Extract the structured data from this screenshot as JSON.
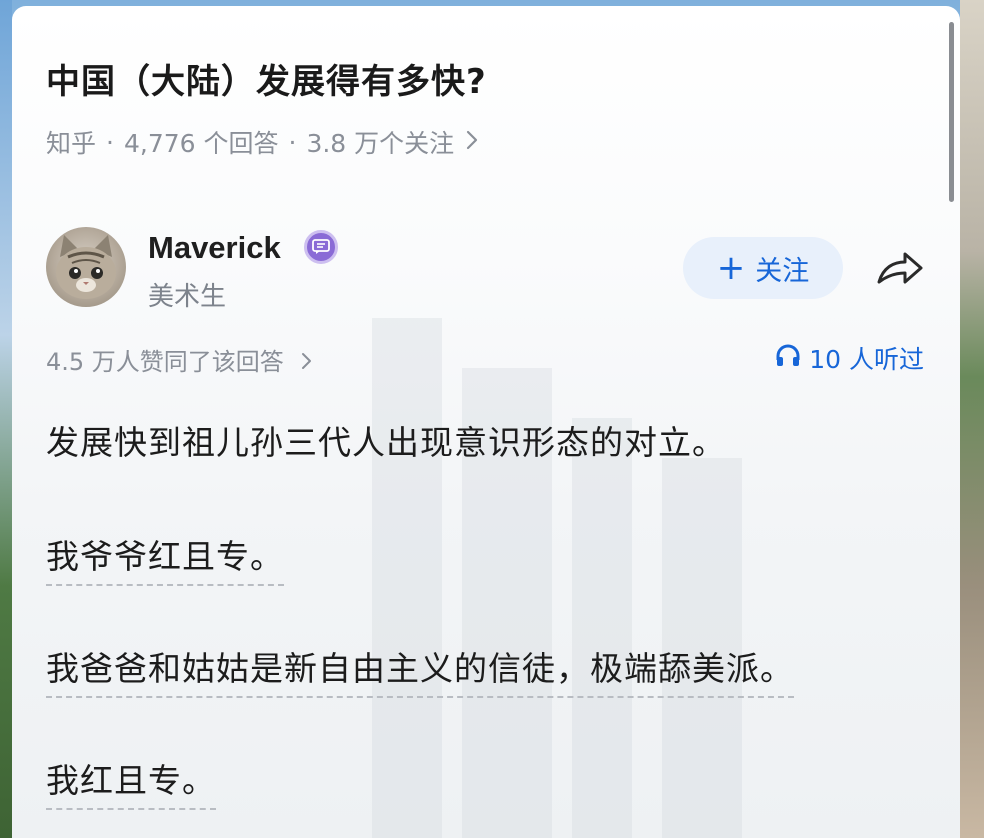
{
  "question": {
    "title": "中国（大陆）发展得有多快?",
    "source": "知乎",
    "answers_count": "4,776 个回答",
    "followers_count": "3.8 万个关注"
  },
  "author": {
    "name": "Maverick",
    "title": "美术生",
    "follow_label": "关注"
  },
  "stats": {
    "likes_text": "4.5 万人赞同了该回答",
    "listened_text": "10 人听过"
  },
  "content": {
    "paragraphs": [
      "发展快到祖儿孙三代人出现意识形态的对立。",
      "我爷爷红且专。",
      "我爸爸和姑姑是新自由主义的信徒，极端舔美派。",
      "我红且专。"
    ]
  },
  "colors": {
    "accent": "#1766d8",
    "follow_bg": "#e8f0fb",
    "meta_gray": "#8a8f98",
    "badge_purple": "#8a6bd6"
  },
  "icons": {
    "chevron": "chevron-right-icon",
    "badge": "creator-badge-icon",
    "share": "share-icon",
    "headphones": "headphones-icon"
  }
}
